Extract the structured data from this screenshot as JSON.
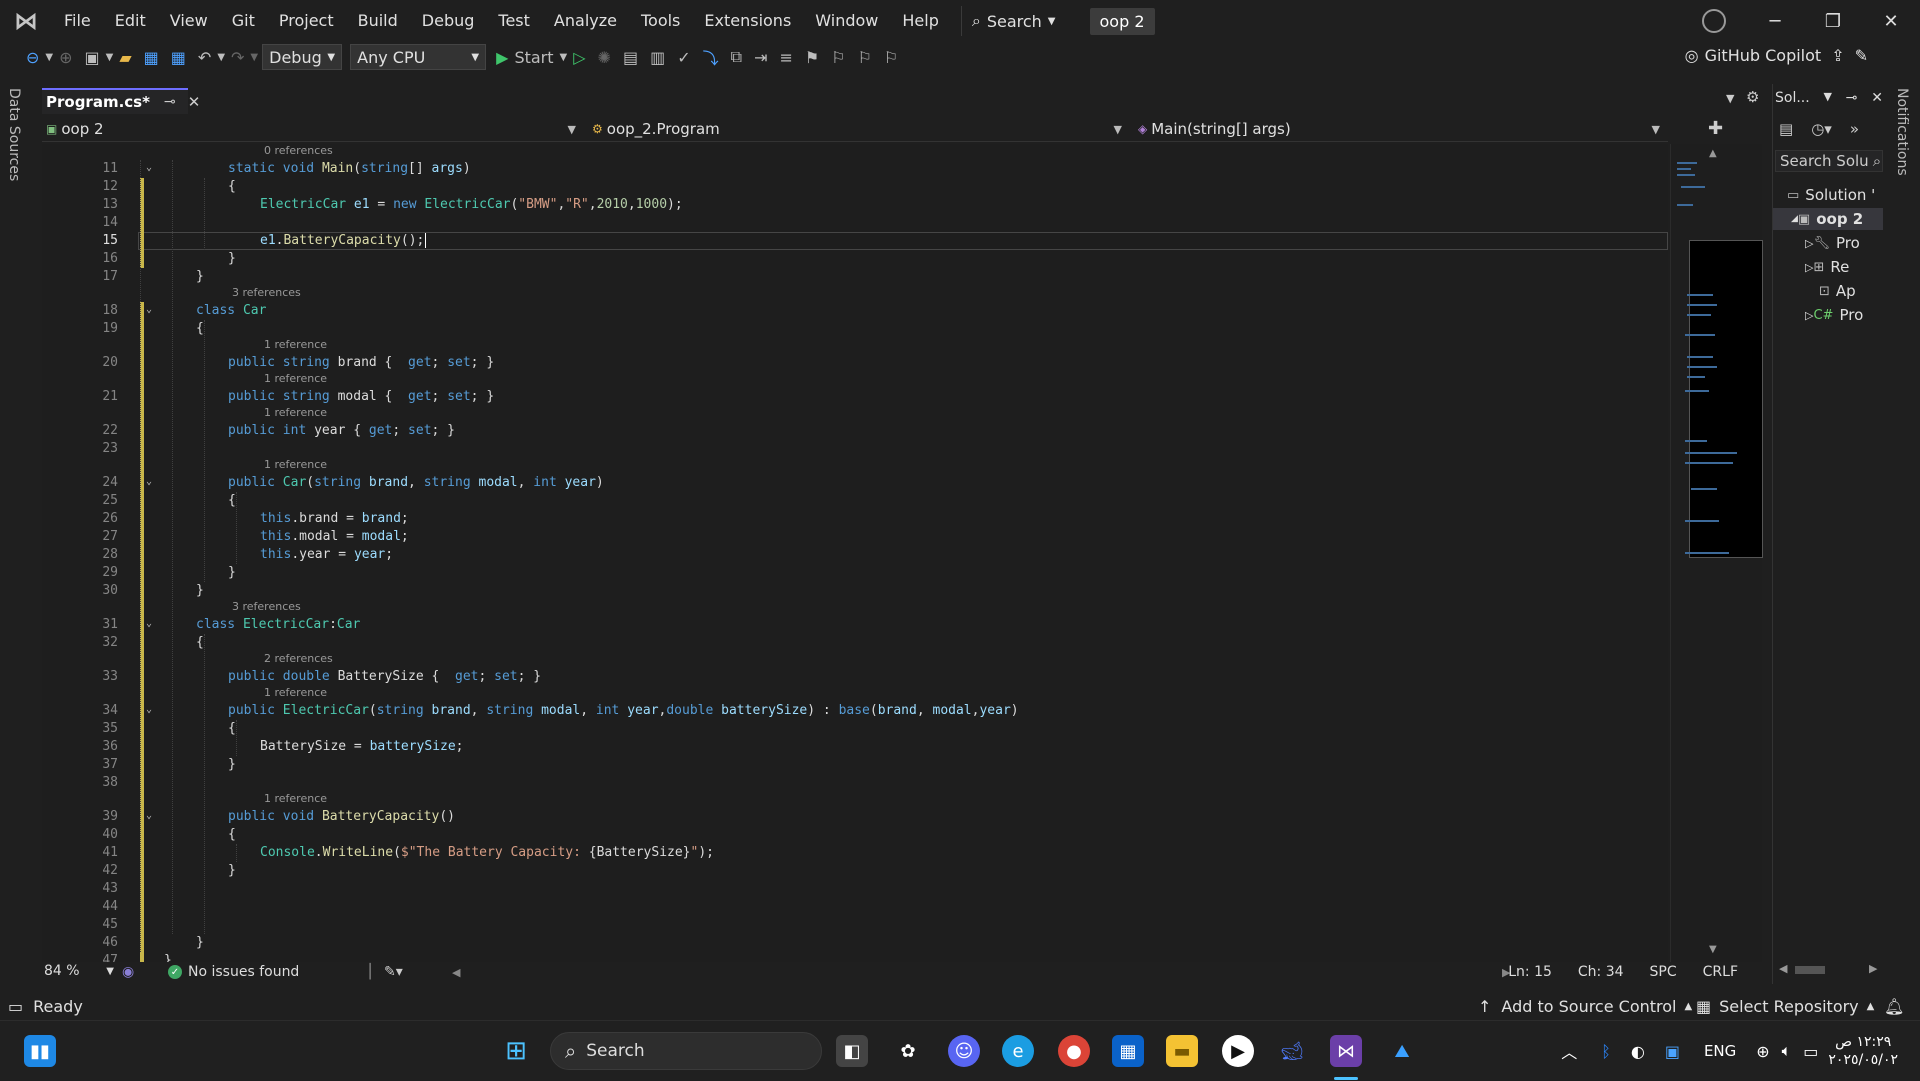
{
  "menu": [
    "File",
    "Edit",
    "View",
    "Git",
    "Project",
    "Build",
    "Debug",
    "Test",
    "Analyze",
    "Tools",
    "Extensions",
    "Window",
    "Help"
  ],
  "search_label": "Search",
  "solution_badge": "oop 2",
  "toolbar": {
    "config": "Debug",
    "platform": "Any CPU",
    "start": "Start",
    "copilot": "GitHub Copilot"
  },
  "left_strip": "Data Sources",
  "right_strip": "Notifications",
  "tab": {
    "title": "Program.cs*"
  },
  "nav": {
    "project": "oop 2",
    "class": "oop_2.Program",
    "member": "Main(string[] args)"
  },
  "code_lines": [
    {
      "n": "11",
      "fold": true,
      "ref": "0 references",
      "indent": 2,
      "html": "<span class=\"kw\">static</span> <span class=\"kw\">void</span> <span class=\"fn\">Main</span>(<span class=\"kw\">string</span>[] <span class=\"pr\">args</span>)"
    },
    {
      "n": "12",
      "indent": 2,
      "html": "{"
    },
    {
      "n": "13",
      "indent": 3,
      "html": "<span class=\"ty\">ElectricCar</span> <span class=\"vr\">e1</span> = <span class=\"kw\">new</span> <span class=\"ty\">ElectricCar</span>(<span class=\"st\">\"BMW\"</span>,<span class=\"st\">\"R\"</span>,<span class=\"nm\">2010</span>,<span class=\"nm\">1000</span>);"
    },
    {
      "n": "14",
      "indent": 3,
      "html": ""
    },
    {
      "n": "15",
      "indent": 3,
      "cur": true,
      "html": "<span class=\"vr\">e1</span>.<span class=\"fn\">BatteryCapacity</span>();"
    },
    {
      "n": "16",
      "indent": 2,
      "html": "}"
    },
    {
      "n": "17",
      "indent": 1,
      "html": "}"
    },
    {
      "n": "18",
      "fold": true,
      "ref": "3 references",
      "indent": 1,
      "html": "<span class=\"kw\">class</span> <span class=\"ty\">Car</span>"
    },
    {
      "n": "19",
      "indent": 1,
      "html": "{"
    },
    {
      "n": "20",
      "ref": "1 reference",
      "indent": 2,
      "html": "<span class=\"kw\">public</span> <span class=\"kw\">string</span> brand {  <span class=\"kw\">get</span>; <span class=\"kw\">set</span>; }"
    },
    {
      "n": "21",
      "ref": "1 reference",
      "indent": 2,
      "html": "<span class=\"kw\">public</span> <span class=\"kw\">string</span> modal {  <span class=\"kw\">get</span>; <span class=\"kw\">set</span>; }"
    },
    {
      "n": "22",
      "ref": "1 reference",
      "indent": 2,
      "html": "<span class=\"kw\">public</span> <span class=\"kw\">int</span> year { <span class=\"kw\">get</span>; <span class=\"kw\">set</span>; }"
    },
    {
      "n": "23",
      "indent": 2,
      "html": ""
    },
    {
      "n": "24",
      "fold": true,
      "ref": "1 reference",
      "indent": 2,
      "html": "<span class=\"kw\">public</span> <span class=\"ty\">Car</span>(<span class=\"kw\">string</span> <span class=\"pr\">brand</span>, <span class=\"kw\">string</span> <span class=\"pr\">modal</span>, <span class=\"kw\">int</span> <span class=\"pr\">year</span>)"
    },
    {
      "n": "25",
      "indent": 2,
      "html": "{"
    },
    {
      "n": "26",
      "indent": 3,
      "html": "<span class=\"kw\">this</span>.brand = <span class=\"pr\">brand</span>;"
    },
    {
      "n": "27",
      "indent": 3,
      "html": "<span class=\"kw\">this</span>.modal = <span class=\"pr\">modal</span>;"
    },
    {
      "n": "28",
      "indent": 3,
      "html": "<span class=\"kw\">this</span>.year = <span class=\"pr\">year</span>;"
    },
    {
      "n": "29",
      "indent": 2,
      "html": "}"
    },
    {
      "n": "30",
      "indent": 1,
      "html": "}"
    },
    {
      "n": "31",
      "fold": true,
      "ref": "3 references",
      "indent": 1,
      "html": "<span class=\"kw\">class</span> <span class=\"ty\">ElectricCar</span>:<span class=\"ty\">Car</span>"
    },
    {
      "n": "32",
      "indent": 1,
      "html": "{"
    },
    {
      "n": "33",
      "ref": "2 references",
      "indent": 2,
      "html": "<span class=\"kw\">public</span> <span class=\"kw\">double</span> BatterySize {  <span class=\"kw\">get</span>; <span class=\"kw\">set</span>; }"
    },
    {
      "n": "34",
      "fold": true,
      "ref": "1 reference",
      "indent": 2,
      "html": "<span class=\"kw\">public</span> <span class=\"ty\">ElectricCar</span>(<span class=\"kw\">string</span> <span class=\"pr\">brand</span>, <span class=\"kw\">string</span> <span class=\"pr\">modal</span>, <span class=\"kw\">int</span> <span class=\"pr\">year</span>,<span class=\"kw\">double</span> <span class=\"pr\">batterySize</span>) : <span class=\"kw\">base</span>(<span class=\"pr\">brand</span>, <span class=\"pr\">modal</span>,<span class=\"pr\">year</span>)"
    },
    {
      "n": "35",
      "indent": 2,
      "html": "{"
    },
    {
      "n": "36",
      "indent": 3,
      "html": "BatterySize = <span class=\"pr\">batterySize</span>;"
    },
    {
      "n": "37",
      "indent": 2,
      "html": "}"
    },
    {
      "n": "38",
      "indent": 2,
      "html": ""
    },
    {
      "n": "39",
      "fold": true,
      "ref": "1 reference",
      "indent": 2,
      "html": "<span class=\"kw\">public</span> <span class=\"kw\">void</span> <span class=\"fn\">BatteryCapacity</span>()"
    },
    {
      "n": "40",
      "indent": 2,
      "html": "{"
    },
    {
      "n": "41",
      "indent": 3,
      "html": "<span class=\"ty\">Console</span>.<span class=\"fn\">WriteLine</span>(<span class=\"st\">$\"The Battery Capacity: </span>{BatterySize}<span class=\"st\">\"</span>);"
    },
    {
      "n": "42",
      "indent": 2,
      "html": "}"
    },
    {
      "n": "43",
      "indent": 2,
      "html": ""
    },
    {
      "n": "44",
      "indent": 2,
      "html": ""
    },
    {
      "n": "45",
      "indent": 2,
      "html": ""
    },
    {
      "n": "46",
      "indent": 1,
      "html": "}"
    },
    {
      "n": "47",
      "indent": 0,
      "html": "}"
    }
  ],
  "editor_status": {
    "zoom": "84 %",
    "issues": "No issues found",
    "ln": "Ln: 15",
    "ch": "Ch: 34",
    "spc": "SPC",
    "crlf": "CRLF"
  },
  "solution_explorer": {
    "title": "Sol...",
    "search": "Search Solu",
    "items": [
      {
        "label": "Solution '",
        "level": 0
      },
      {
        "label": "oop 2",
        "level": 1,
        "selected": true
      },
      {
        "label": "Pro",
        "level": 2
      },
      {
        "label": "Re",
        "level": 2
      },
      {
        "label": "Ap",
        "level": 2
      },
      {
        "label": "Pro",
        "level": 2
      }
    ]
  },
  "statusbar": {
    "ready": "Ready",
    "source_control": "Add to Source Control",
    "repository": "Select Repository"
  },
  "taskbar": {
    "search": "Search",
    "lang": "ENG",
    "time": "١٢:٢٩ ص",
    "date": "٢٠٢٥/٠٥/٠٢"
  }
}
